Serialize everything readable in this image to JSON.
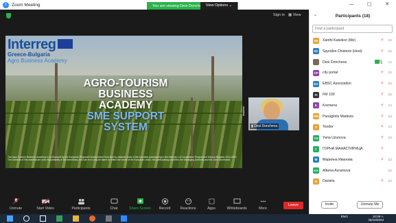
{
  "window": {
    "title": "Zoom Meeting"
  },
  "share_banner": {
    "text": "You are viewing Desi Doncheva's screen",
    "view_options": "View Options"
  },
  "top_right": {
    "sign_in": "Sign in",
    "view": "View"
  },
  "slide": {
    "brand": "Interreg",
    "brand_sub": "Greece-Bulgaria",
    "brand_sub2": "Agro Business Academy",
    "title_lines": [
      "AGRO-TOURISM",
      "BUSINESS",
      "ACADEMY"
    ],
    "subtitle_lines": [
      "SME SUPPORT",
      "SYSTEM"
    ],
    "disclaimer": "The Agro-Tourism Business Academy is co-financed by the European Regional Development Fund and by national funds of the countries participating in the Interreg V-A Cooperation Programme Greece-Bulgaria 2014-2020. The contents of this material are sole responsibility of the beneficiary and can in no way be taken to reflect the views of the European Union, the participating countries, the Managing Authority and the Joint Secretariat."
  },
  "video": {
    "name": "Desi Doncheva"
  },
  "toolbar": {
    "unmute": "Unmute",
    "start_video": "Start Video",
    "participants": "Participants",
    "participants_count": "18",
    "chat": "Chat",
    "share_screen": "Share Screen",
    "record": "Record",
    "reactions": "Reactions",
    "apps": "Apps",
    "whiteboards": "Whiteboards",
    "more": "More",
    "leave": "Leave"
  },
  "panel": {
    "title": "Participants (18)",
    "search_placeholder": "Find a participant",
    "participants": [
      {
        "initials": "XK",
        "name": "Xanthi Katsikori (Me)",
        "color": "#e8a33b",
        "mic": "muted",
        "cam": "off"
      },
      {
        "initials": "SC",
        "name": "Spyridon Chisteris (Host)",
        "color": "#2d7fc1",
        "mic": "muted",
        "cam": "off"
      },
      {
        "initials": "",
        "name": "Desi Doncheva",
        "color": "#7b6a55",
        "mic": "on",
        "cam": "on",
        "live": true
      },
      {
        "initials": "CP",
        "name": "city portal",
        "color": "#8e44ad",
        "mic": "muted",
        "cam": "off"
      },
      {
        "initials": "EA",
        "name": "EBSC Association",
        "color": "#2d7fc1",
        "mic": "muted",
        "cam": "off"
      },
      {
        "initials": "FI",
        "name": "FM 100",
        "color": "#333333",
        "mic": "muted",
        "cam": "off"
      },
      {
        "initials": "K",
        "name": "Kremena",
        "color": "#8e44ad",
        "mic": "muted",
        "cam": "on"
      },
      {
        "initials": "PM",
        "name": "Panagiotis Madesis",
        "color": "#e8a33b",
        "mic": "muted",
        "cam": "off"
      },
      {
        "initials": "T",
        "name": "Teodor",
        "color": "#e8a33b",
        "mic": "muted",
        "cam": "on"
      },
      {
        "initials": "YU",
        "name": "Yana Uzunova",
        "color": "#27ae60",
        "mic": "muted",
        "cam": "off"
      },
      {
        "initials": "Г",
        "name": "ГОРНА МАНАСТИРИЦА",
        "color": "#27ae60",
        "mic": "muted",
        "cam": "none"
      },
      {
        "initials": "M",
        "name": "Марияна Иванова",
        "color": "#2d7fc1",
        "mic": "muted",
        "cam": "off"
      },
      {
        "initials": "AA",
        "name": "Albena Avramova",
        "color": "#27ae60",
        "mic": "none",
        "cam": "off"
      },
      {
        "initials": "D",
        "name": "Daniela",
        "color": "#e8a33b",
        "mic": "muted",
        "cam": "off"
      }
    ],
    "invite": "Invite",
    "unmute_me": "Unmute Me"
  },
  "taskbar": {
    "lang": "ENG",
    "time": "10:09 ч.",
    "date": "25/10/2023"
  }
}
